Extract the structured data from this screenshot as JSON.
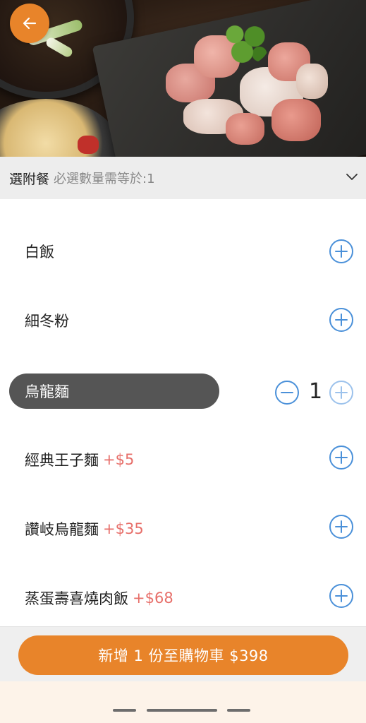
{
  "colors": {
    "accent": "#e8842a",
    "price": "#e76f6a",
    "circle": "#4a90d9",
    "circle_disabled": "#9cc2ec",
    "selected_bg": "#555555"
  },
  "header": {
    "back_icon": "arrow-left-icon"
  },
  "section": {
    "title": "選附餐",
    "note": "必選數量需等於:1",
    "toggle_icon": "chevron-down-icon"
  },
  "options": [
    {
      "name": "白飯",
      "price": "",
      "selected": false
    },
    {
      "name": "細冬粉",
      "price": "",
      "selected": false
    },
    {
      "name": "烏龍麵",
      "price": "",
      "selected": true,
      "quantity": "1"
    },
    {
      "name": "經典王子麵",
      "price": "+$5",
      "selected": false
    },
    {
      "name": "讚岐烏龍麵",
      "price": "+$35",
      "selected": false
    },
    {
      "name": "蒸蛋壽喜燒肉飯",
      "price": "+$68",
      "selected": false
    }
  ],
  "icons": {
    "plus": "plus-circle-icon",
    "minus": "minus-circle-icon"
  },
  "cart": {
    "button_label": "新增 1 份至購物車 $398"
  }
}
